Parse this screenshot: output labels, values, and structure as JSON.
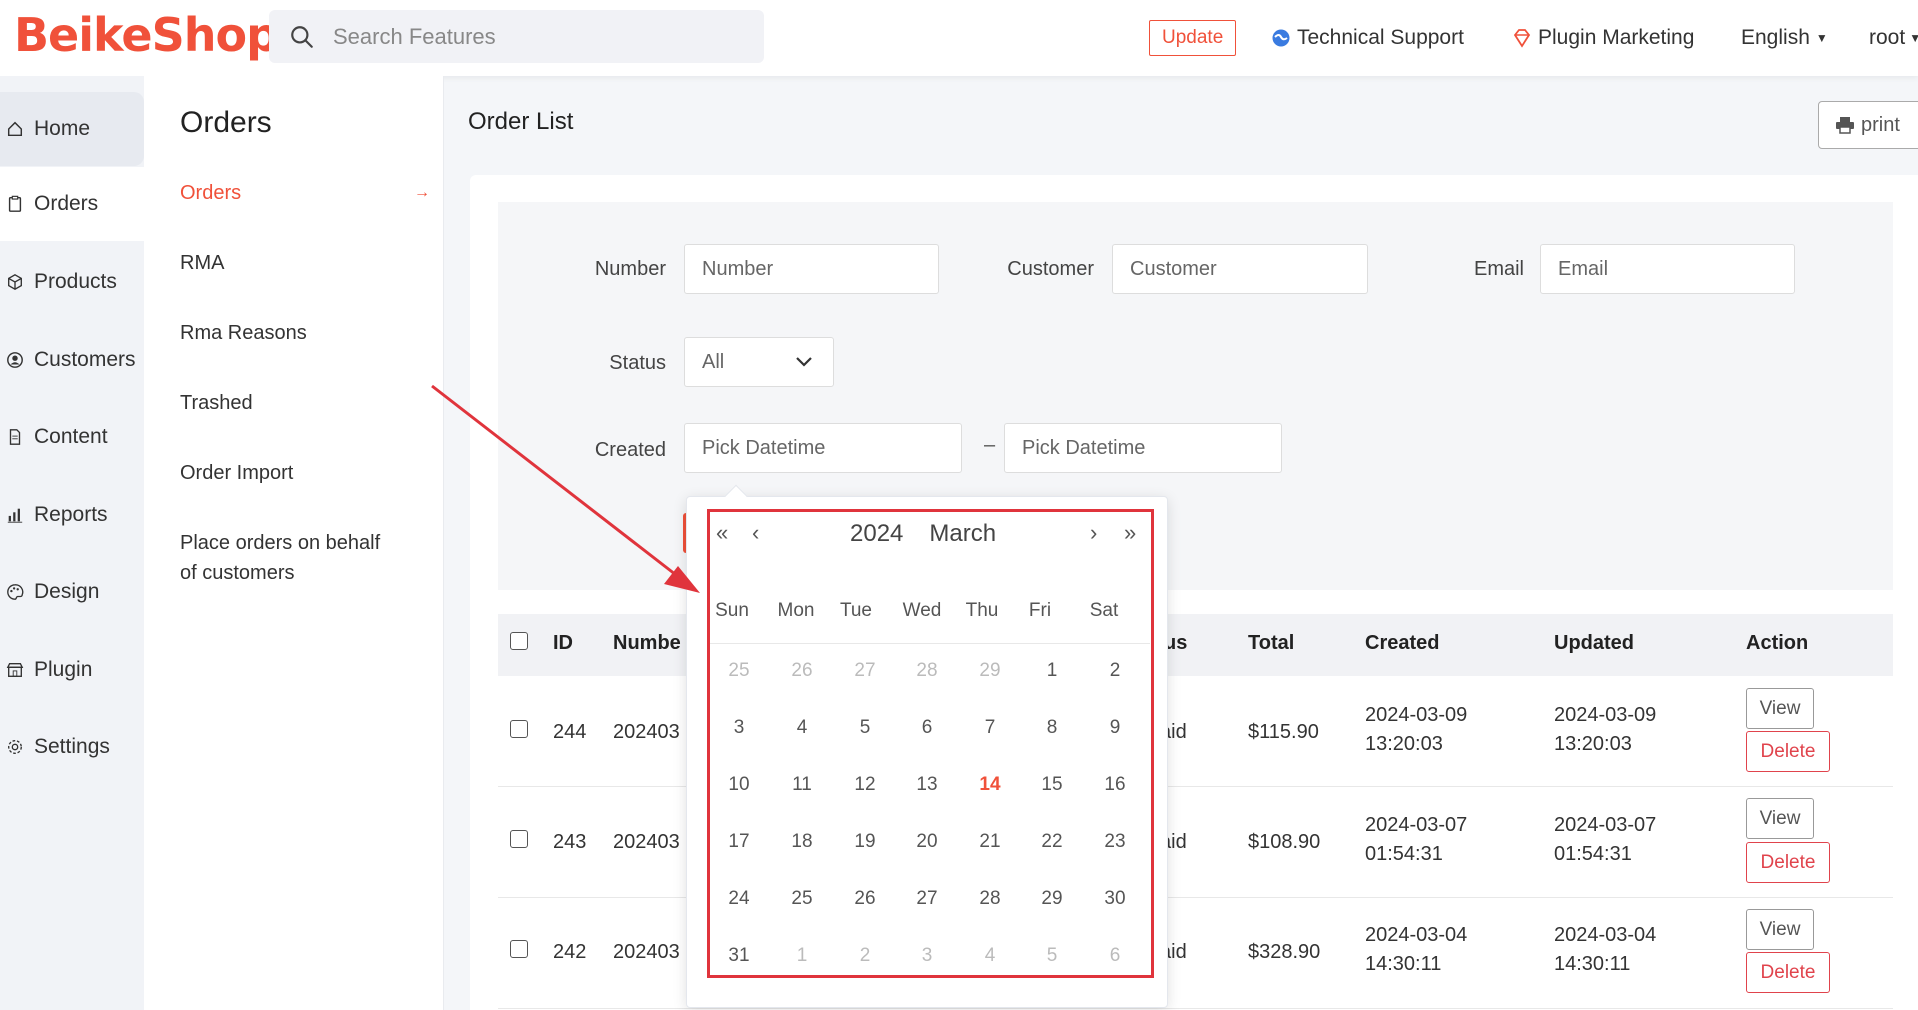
{
  "header": {
    "logo": "BeikeShop",
    "search_placeholder": "Search Features",
    "update_label": "Update",
    "technical_support": "Technical Support",
    "plugin_marketing": "Plugin Marketing",
    "language": "English",
    "user": "root"
  },
  "sidebar": {
    "items": [
      {
        "label": "Home",
        "icon": "home-icon"
      },
      {
        "label": "Orders",
        "icon": "clipboard-icon"
      },
      {
        "label": "Products",
        "icon": "box-icon"
      },
      {
        "label": "Customers",
        "icon": "user-circle-icon"
      },
      {
        "label": "Content",
        "icon": "file-icon"
      },
      {
        "label": "Reports",
        "icon": "bar-chart-icon"
      },
      {
        "label": "Design",
        "icon": "palette-icon"
      },
      {
        "label": "Plugin",
        "icon": "store-icon"
      },
      {
        "label": "Settings",
        "icon": "gear-icon"
      }
    ]
  },
  "subnav": {
    "title": "Orders",
    "items": [
      "Orders",
      "RMA",
      "Rma Reasons",
      "Trashed",
      "Order Import"
    ],
    "behalf_line1": "Place orders on behalf",
    "behalf_line2": "of customers"
  },
  "main": {
    "title": "Order List",
    "print_label": "print"
  },
  "filters": {
    "number_label": "Number",
    "number_placeholder": "Number",
    "customer_label": "Customer",
    "customer_placeholder": "Customer",
    "email_label": "Email",
    "email_placeholder": "Email",
    "status_label": "Status",
    "status_value": "All",
    "created_label": "Created",
    "date_from_placeholder": "Pick Datetime",
    "date_to_placeholder": "Pick Datetime",
    "dash": "–"
  },
  "table": {
    "headers": {
      "id": "ID",
      "number": "Numbe",
      "status": "us",
      "total": "Total",
      "created": "Created",
      "updated": "Updated",
      "action": "Action"
    },
    "rows": [
      {
        "id": "244",
        "number": "202403",
        "status": "aid",
        "total": "$115.90",
        "created_date": "2024-03-09",
        "created_time": "13:20:03",
        "updated_date": "2024-03-09",
        "updated_time": "13:20:03"
      },
      {
        "id": "243",
        "number": "202403",
        "status": "aid",
        "total": "$108.90",
        "created_date": "2024-03-07",
        "created_time": "01:54:31",
        "updated_date": "2024-03-07",
        "updated_time": "01:54:31"
      },
      {
        "id": "242",
        "number": "202403",
        "status": "aid",
        "total": "$328.90",
        "created_date": "2024-03-04",
        "created_time": "14:30:11",
        "updated_date": "2024-03-04",
        "updated_time": "14:30:11"
      }
    ],
    "view_label": "View",
    "delete_label": "Delete"
  },
  "datepicker": {
    "year": "2024",
    "month": "March",
    "weekdays": [
      "Sun",
      "Mon",
      "Tue",
      "Wed",
      "Thu",
      "Fri",
      "Sat"
    ],
    "weeks": [
      [
        "25",
        "26",
        "27",
        "28",
        "29",
        "1",
        "2"
      ],
      [
        "3",
        "4",
        "5",
        "6",
        "7",
        "8",
        "9"
      ],
      [
        "10",
        "11",
        "12",
        "13",
        "14",
        "15",
        "16"
      ],
      [
        "17",
        "18",
        "19",
        "20",
        "21",
        "22",
        "23"
      ],
      [
        "24",
        "25",
        "26",
        "27",
        "28",
        "29",
        "30"
      ],
      [
        "31",
        "1",
        "2",
        "3",
        "4",
        "5",
        "6"
      ]
    ],
    "today": "14"
  },
  "colors": {
    "brand": "#f0513a",
    "danger": "#e0434c",
    "highlight": "#e0343c"
  }
}
